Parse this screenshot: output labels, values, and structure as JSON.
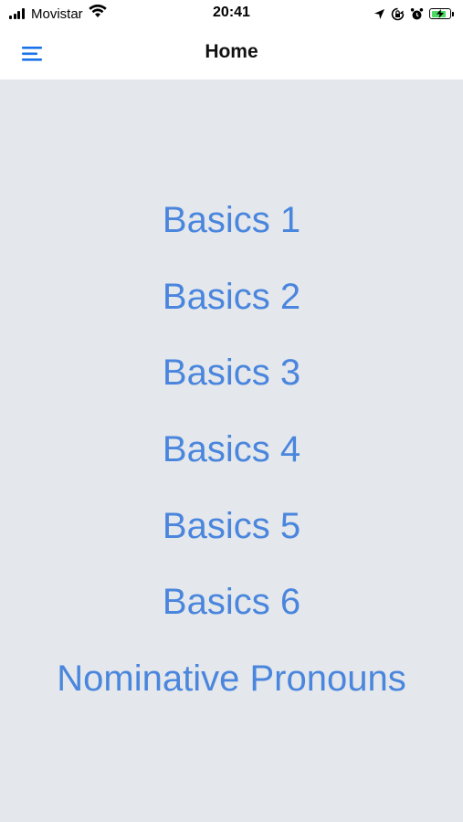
{
  "status_bar": {
    "carrier": "Movistar",
    "time": "20:41",
    "battery_level": 0.85,
    "battery_color": "#4cd964",
    "icons": [
      "signal-icon",
      "wifi-icon",
      "location-arrow-icon",
      "screen-lock-icon",
      "alarm-icon",
      "battery-charging-icon"
    ]
  },
  "nav": {
    "title": "Home",
    "menu_icon": "hamburger-menu-icon",
    "accent_color": "#1a73e8"
  },
  "lessons": [
    {
      "label": "Basics 1"
    },
    {
      "label": "Basics 2"
    },
    {
      "label": "Basics 3"
    },
    {
      "label": "Basics 4"
    },
    {
      "label": "Basics 5"
    },
    {
      "label": "Basics 6"
    },
    {
      "label": "Nominative Pronouns"
    }
  ],
  "theme": {
    "background": "#e4e7ec",
    "link_color": "#4a86dd"
  }
}
